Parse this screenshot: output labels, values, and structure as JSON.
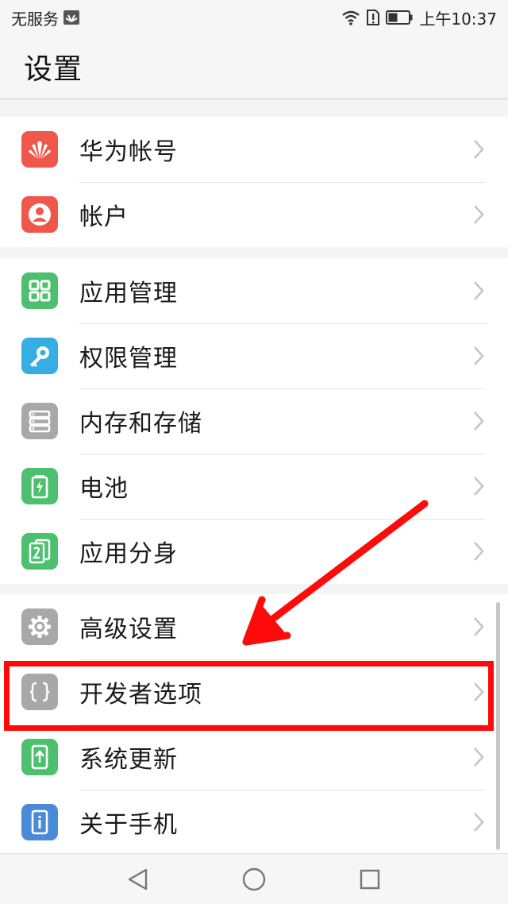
{
  "status_bar": {
    "carrier": "无服务",
    "time": "上午10:37"
  },
  "header": {
    "title": "设置"
  },
  "groups": [
    {
      "items": [
        {
          "label": "华为帐号",
          "icon": "huawei-logo-icon",
          "color": "#f0574b"
        },
        {
          "label": "帐户",
          "icon": "account-person-icon",
          "color": "#f0574b"
        }
      ]
    },
    {
      "items": [
        {
          "label": "应用管理",
          "icon": "app-grid-icon",
          "color": "#4cc06e"
        },
        {
          "label": "权限管理",
          "icon": "key-icon",
          "color": "#35aee3"
        },
        {
          "label": "内存和存储",
          "icon": "storage-icon",
          "color": "#a8a8a8"
        },
        {
          "label": "电池",
          "icon": "battery-icon",
          "color": "#4cc06e"
        },
        {
          "label": "应用分身",
          "icon": "app-twin-icon",
          "color": "#4cc06e"
        }
      ]
    },
    {
      "items": [
        {
          "label": "高级设置",
          "icon": "gear-icon",
          "color": "#a8a8a8"
        },
        {
          "label": "开发者选项",
          "icon": "braces-icon",
          "color": "#a8a8a8"
        },
        {
          "label": "系统更新",
          "icon": "system-update-icon",
          "color": "#4cc06e"
        },
        {
          "label": "关于手机",
          "icon": "phone-info-icon",
          "color": "#4a8ad6"
        }
      ]
    }
  ],
  "colors": {
    "annotation_red": "#ff0a0a",
    "chevron": "#c4c4c4"
  }
}
